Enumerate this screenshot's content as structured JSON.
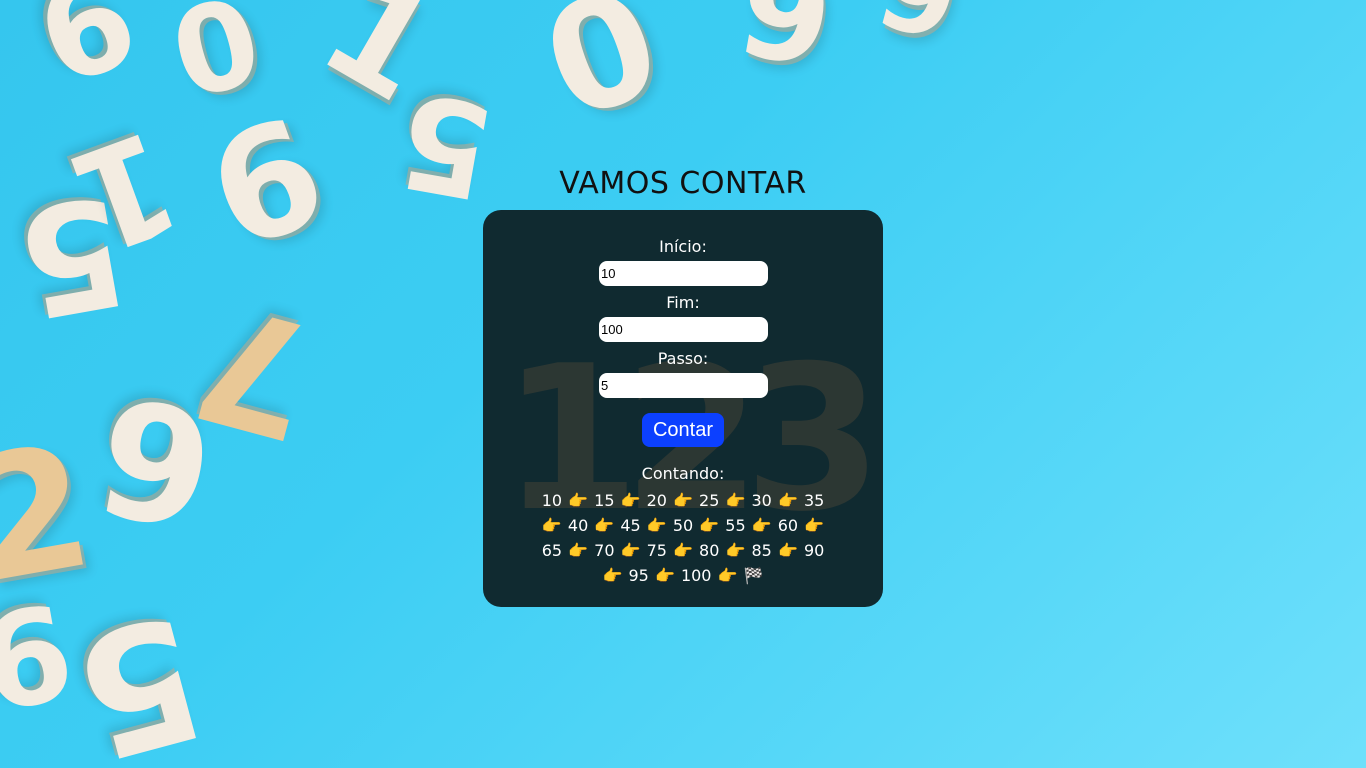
{
  "background": {
    "digits": [
      "9",
      "0",
      "1",
      "5",
      "0",
      "9",
      "9",
      "5",
      "6",
      "1",
      "6",
      "7",
      "2",
      "9",
      "5"
    ]
  },
  "page": {
    "title": "VAMOS CONTAR"
  },
  "panel": {
    "watermark": "123"
  },
  "form": {
    "inicio_label": "Início:",
    "inicio_value": "10",
    "fim_label": "Fim:",
    "fim_value": "100",
    "passo_label": "Passo:",
    "passo_value": "5",
    "button_label": "Contar"
  },
  "result": {
    "label": "Contando:",
    "sequence": "10 👉 15 👉 20 👉 25 👉 30 👉 35 👉 40 👉 45 👉 50 👉 55 👉 60 👉 65 👉 70 👉 75 👉 80 👉 85 👉 90 👉 95 👉 100 👉 🏁"
  },
  "colors": {
    "background": "#3ccdf3",
    "panel": "#102a30",
    "button": "#0c40ff",
    "text_light": "#ffffff",
    "title": "#111111"
  }
}
